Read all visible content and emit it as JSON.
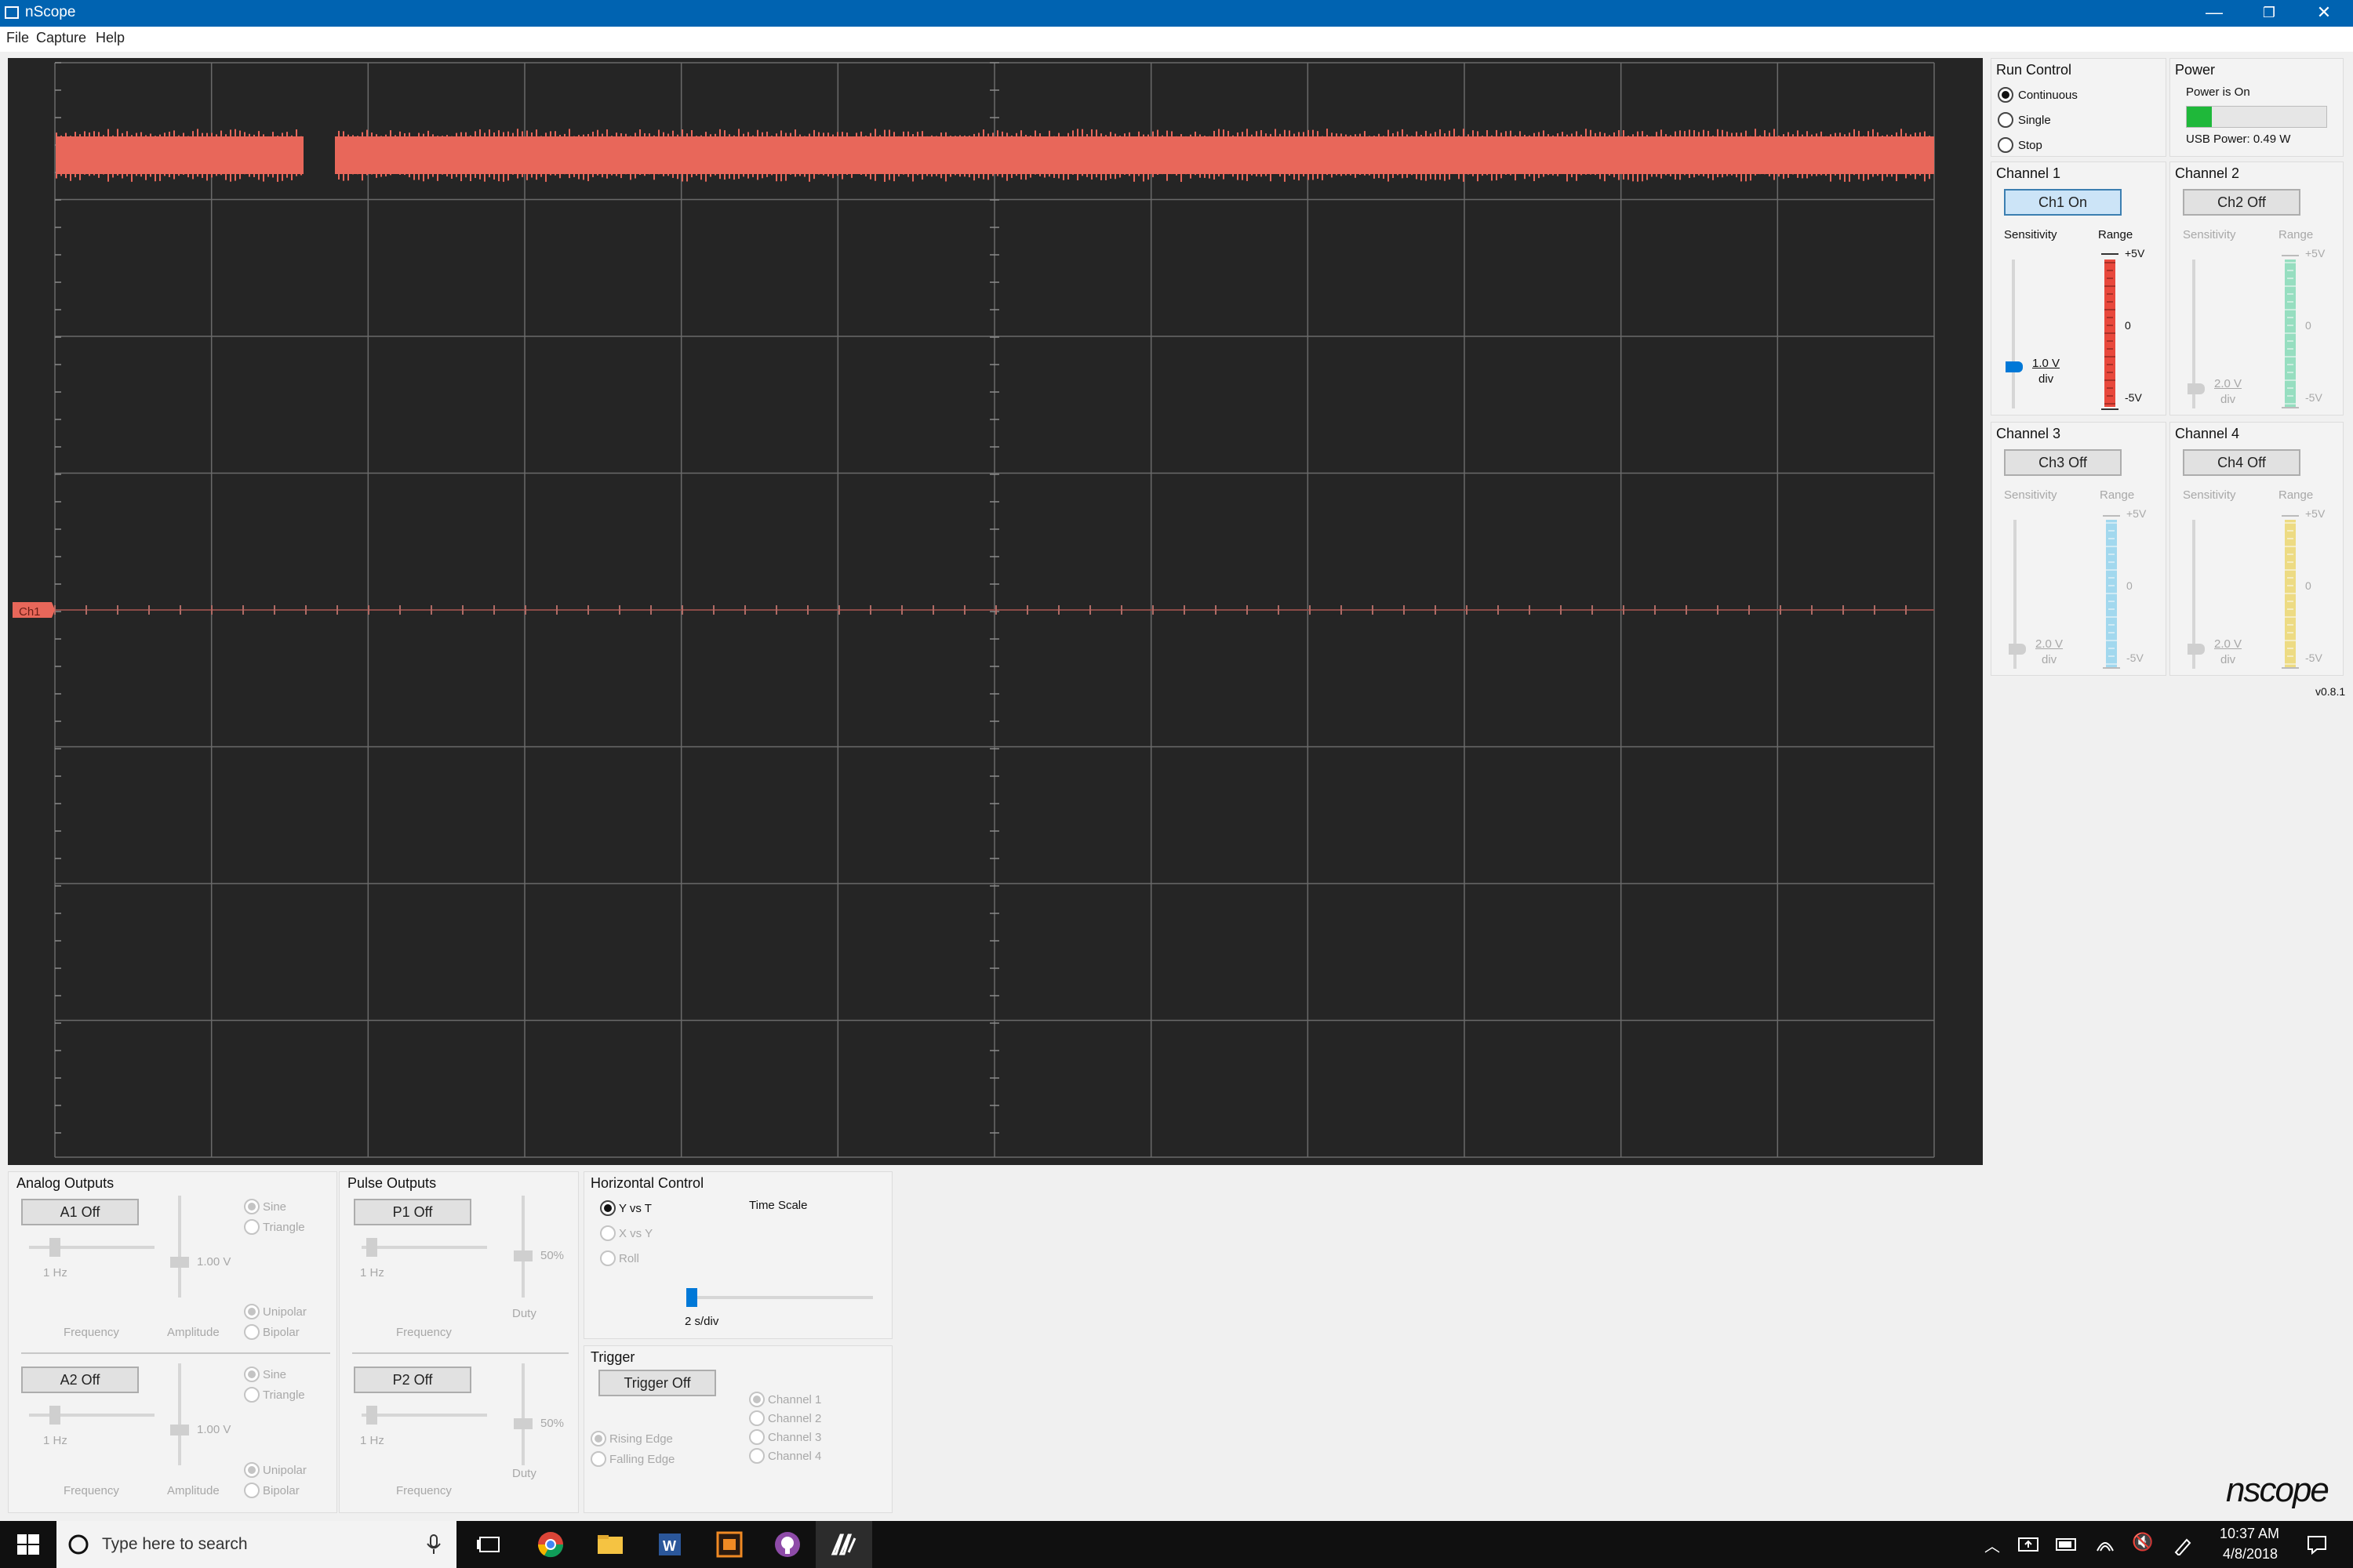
{
  "window": {
    "title": "nScope",
    "minimize": "—",
    "maximize": "❐",
    "close": "✕"
  },
  "menu": [
    "File",
    "Capture",
    "Help"
  ],
  "scope": {
    "marker_label": "Ch1",
    "trace_color": "#e8675a"
  },
  "run_control": {
    "title": "Run Control",
    "options": [
      "Continuous",
      "Single",
      "Stop"
    ],
    "selected": "Continuous"
  },
  "power": {
    "title": "Power",
    "status": "Power is On",
    "usb": "USB Power: 0.49 W",
    "level_fraction": 0.18,
    "color": "#1fb83a"
  },
  "channels": [
    {
      "title": "Channel 1",
      "button": "Ch1 On",
      "on": true,
      "sens_label": "Sensitivity",
      "range_label": "Range",
      "value": "1.0 V",
      "unit": "div",
      "top": "+5V",
      "mid": "0",
      "bot": "-5V",
      "color": "#e8483c"
    },
    {
      "title": "Channel 2",
      "button": "Ch2 Off",
      "on": false,
      "sens_label": "Sensitivity",
      "range_label": "Range",
      "value": "2.0 V",
      "unit": "div",
      "top": "+5V",
      "mid": "0",
      "bot": "-5V",
      "color": "#7fd9b4"
    },
    {
      "title": "Channel 3",
      "button": "Ch3 Off",
      "on": false,
      "sens_label": "Sensitivity",
      "range_label": "Range",
      "value": "2.0 V",
      "unit": "div",
      "top": "+5V",
      "mid": "0",
      "bot": "-5V",
      "color": "#8fd2ee"
    },
    {
      "title": "Channel 4",
      "button": "Ch4 Off",
      "on": false,
      "sens_label": "Sensitivity",
      "range_label": "Range",
      "value": "2.0 V",
      "unit": "div",
      "top": "+5V",
      "mid": "0",
      "bot": "-5V",
      "color": "#ecd668"
    }
  ],
  "version": "v0.8.1",
  "analog_outputs": {
    "title": "Analog Outputs",
    "a1": {
      "button": "A1 Off",
      "freq": "1 Hz",
      "amp": "1.00 V",
      "freq_label": "Frequency",
      "amp_label": "Amplitude",
      "wave": [
        "Sine",
        "Triangle"
      ],
      "polarity": [
        "Unipolar",
        "Bipolar"
      ]
    },
    "a2": {
      "button": "A2 Off",
      "freq": "1 Hz",
      "amp": "1.00 V",
      "freq_label": "Frequency",
      "amp_label": "Amplitude",
      "wave": [
        "Sine",
        "Triangle"
      ],
      "polarity": [
        "Unipolar",
        "Bipolar"
      ]
    }
  },
  "pulse_outputs": {
    "title": "Pulse Outputs",
    "p1": {
      "button": "P1 Off",
      "freq": "1 Hz",
      "duty": "50%",
      "freq_label": "Frequency",
      "duty_label": "Duty"
    },
    "p2": {
      "button": "P2 Off",
      "freq": "1 Hz",
      "duty": "50%",
      "freq_label": "Frequency",
      "duty_label": "Duty"
    }
  },
  "horizontal": {
    "title": "Horizontal Control",
    "modes": [
      "Y vs T",
      "X vs Y",
      "Roll"
    ],
    "selected": "Y vs T",
    "time_scale_label": "Time Scale",
    "time_scale_value": "2 s/div"
  },
  "trigger": {
    "title": "Trigger",
    "button": "Trigger Off",
    "edges": [
      "Rising Edge",
      "Falling Edge"
    ],
    "channels": [
      "Channel 1",
      "Channel 2",
      "Channel 3",
      "Channel 4"
    ]
  },
  "logo": "nscope",
  "taskbar": {
    "search_placeholder": "Type here to search",
    "time": "10:37 AM",
    "date": "4/8/2018"
  }
}
